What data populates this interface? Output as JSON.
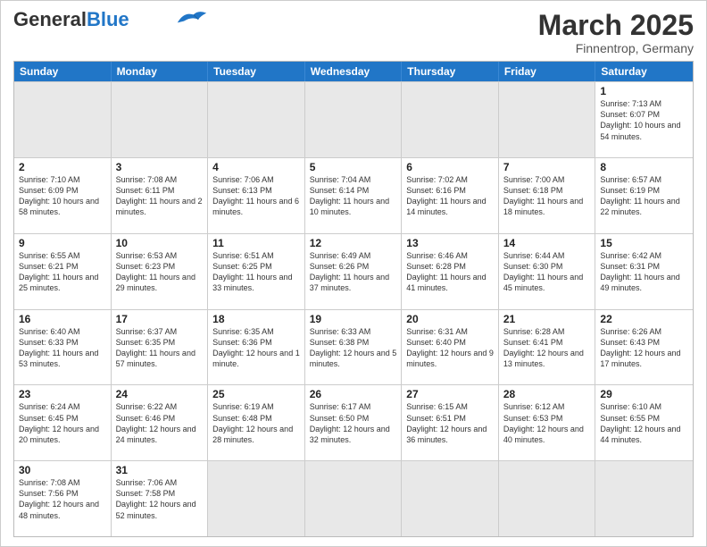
{
  "header": {
    "logo_general": "General",
    "logo_blue": "Blue",
    "month_title": "March 2025",
    "subtitle": "Finnentrop, Germany"
  },
  "days_of_week": [
    "Sunday",
    "Monday",
    "Tuesday",
    "Wednesday",
    "Thursday",
    "Friday",
    "Saturday"
  ],
  "rows": [
    [
      {
        "day": "",
        "info": "",
        "empty": true
      },
      {
        "day": "",
        "info": "",
        "empty": true
      },
      {
        "day": "",
        "info": "",
        "empty": true
      },
      {
        "day": "",
        "info": "",
        "empty": true
      },
      {
        "day": "",
        "info": "",
        "empty": true
      },
      {
        "day": "",
        "info": "",
        "empty": true
      },
      {
        "day": "1",
        "info": "Sunrise: 7:13 AM\nSunset: 6:07 PM\nDaylight: 10 hours and 54 minutes.",
        "empty": false
      }
    ],
    [
      {
        "day": "2",
        "info": "Sunrise: 7:10 AM\nSunset: 6:09 PM\nDaylight: 10 hours and 58 minutes.",
        "empty": false
      },
      {
        "day": "3",
        "info": "Sunrise: 7:08 AM\nSunset: 6:11 PM\nDaylight: 11 hours and 2 minutes.",
        "empty": false
      },
      {
        "day": "4",
        "info": "Sunrise: 7:06 AM\nSunset: 6:13 PM\nDaylight: 11 hours and 6 minutes.",
        "empty": false
      },
      {
        "day": "5",
        "info": "Sunrise: 7:04 AM\nSunset: 6:14 PM\nDaylight: 11 hours and 10 minutes.",
        "empty": false
      },
      {
        "day": "6",
        "info": "Sunrise: 7:02 AM\nSunset: 6:16 PM\nDaylight: 11 hours and 14 minutes.",
        "empty": false
      },
      {
        "day": "7",
        "info": "Sunrise: 7:00 AM\nSunset: 6:18 PM\nDaylight: 11 hours and 18 minutes.",
        "empty": false
      },
      {
        "day": "8",
        "info": "Sunrise: 6:57 AM\nSunset: 6:19 PM\nDaylight: 11 hours and 22 minutes.",
        "empty": false
      }
    ],
    [
      {
        "day": "9",
        "info": "Sunrise: 6:55 AM\nSunset: 6:21 PM\nDaylight: 11 hours and 25 minutes.",
        "empty": false
      },
      {
        "day": "10",
        "info": "Sunrise: 6:53 AM\nSunset: 6:23 PM\nDaylight: 11 hours and 29 minutes.",
        "empty": false
      },
      {
        "day": "11",
        "info": "Sunrise: 6:51 AM\nSunset: 6:25 PM\nDaylight: 11 hours and 33 minutes.",
        "empty": false
      },
      {
        "day": "12",
        "info": "Sunrise: 6:49 AM\nSunset: 6:26 PM\nDaylight: 11 hours and 37 minutes.",
        "empty": false
      },
      {
        "day": "13",
        "info": "Sunrise: 6:46 AM\nSunset: 6:28 PM\nDaylight: 11 hours and 41 minutes.",
        "empty": false
      },
      {
        "day": "14",
        "info": "Sunrise: 6:44 AM\nSunset: 6:30 PM\nDaylight: 11 hours and 45 minutes.",
        "empty": false
      },
      {
        "day": "15",
        "info": "Sunrise: 6:42 AM\nSunset: 6:31 PM\nDaylight: 11 hours and 49 minutes.",
        "empty": false
      }
    ],
    [
      {
        "day": "16",
        "info": "Sunrise: 6:40 AM\nSunset: 6:33 PM\nDaylight: 11 hours and 53 minutes.",
        "empty": false
      },
      {
        "day": "17",
        "info": "Sunrise: 6:37 AM\nSunset: 6:35 PM\nDaylight: 11 hours and 57 minutes.",
        "empty": false
      },
      {
        "day": "18",
        "info": "Sunrise: 6:35 AM\nSunset: 6:36 PM\nDaylight: 12 hours and 1 minute.",
        "empty": false
      },
      {
        "day": "19",
        "info": "Sunrise: 6:33 AM\nSunset: 6:38 PM\nDaylight: 12 hours and 5 minutes.",
        "empty": false
      },
      {
        "day": "20",
        "info": "Sunrise: 6:31 AM\nSunset: 6:40 PM\nDaylight: 12 hours and 9 minutes.",
        "empty": false
      },
      {
        "day": "21",
        "info": "Sunrise: 6:28 AM\nSunset: 6:41 PM\nDaylight: 12 hours and 13 minutes.",
        "empty": false
      },
      {
        "day": "22",
        "info": "Sunrise: 6:26 AM\nSunset: 6:43 PM\nDaylight: 12 hours and 17 minutes.",
        "empty": false
      }
    ],
    [
      {
        "day": "23",
        "info": "Sunrise: 6:24 AM\nSunset: 6:45 PM\nDaylight: 12 hours and 20 minutes.",
        "empty": false
      },
      {
        "day": "24",
        "info": "Sunrise: 6:22 AM\nSunset: 6:46 PM\nDaylight: 12 hours and 24 minutes.",
        "empty": false
      },
      {
        "day": "25",
        "info": "Sunrise: 6:19 AM\nSunset: 6:48 PM\nDaylight: 12 hours and 28 minutes.",
        "empty": false
      },
      {
        "day": "26",
        "info": "Sunrise: 6:17 AM\nSunset: 6:50 PM\nDaylight: 12 hours and 32 minutes.",
        "empty": false
      },
      {
        "day": "27",
        "info": "Sunrise: 6:15 AM\nSunset: 6:51 PM\nDaylight: 12 hours and 36 minutes.",
        "empty": false
      },
      {
        "day": "28",
        "info": "Sunrise: 6:12 AM\nSunset: 6:53 PM\nDaylight: 12 hours and 40 minutes.",
        "empty": false
      },
      {
        "day": "29",
        "info": "Sunrise: 6:10 AM\nSunset: 6:55 PM\nDaylight: 12 hours and 44 minutes.",
        "empty": false
      }
    ],
    [
      {
        "day": "30",
        "info": "Sunrise: 7:08 AM\nSunset: 7:56 PM\nDaylight: 12 hours and 48 minutes.",
        "empty": false
      },
      {
        "day": "31",
        "info": "Sunrise: 7:06 AM\nSunset: 7:58 PM\nDaylight: 12 hours and 52 minutes.",
        "empty": false
      },
      {
        "day": "",
        "info": "",
        "empty": true
      },
      {
        "day": "",
        "info": "",
        "empty": true
      },
      {
        "day": "",
        "info": "",
        "empty": true
      },
      {
        "day": "",
        "info": "",
        "empty": true
      },
      {
        "day": "",
        "info": "",
        "empty": true
      }
    ]
  ]
}
